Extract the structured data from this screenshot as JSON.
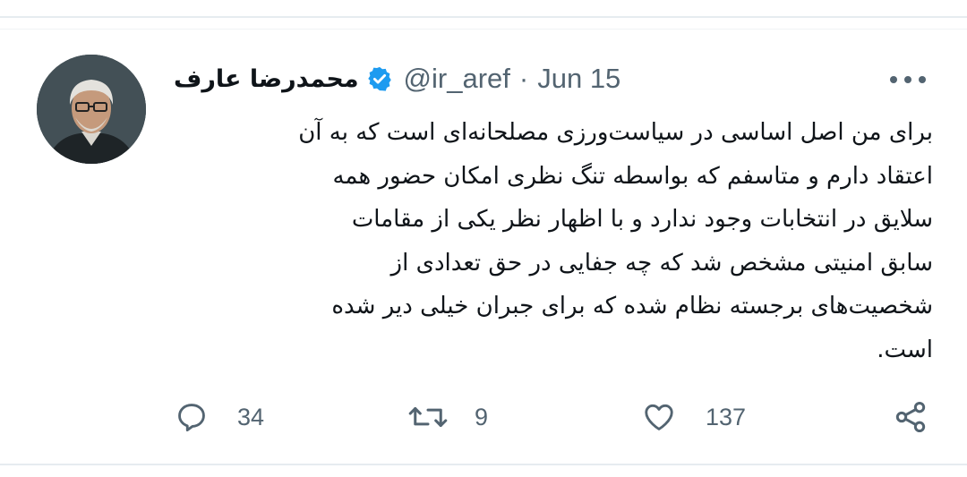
{
  "tweet": {
    "author": {
      "display_name": "محمدرضا عارف",
      "handle": "@ir_aref",
      "verified": true,
      "avatar_icon": "user-avatar-photo"
    },
    "separator": "·",
    "date": "Jun 15",
    "text_lines": [
      "برای من اصل اساسی در  سیاست‌ورزی مصلحانه‌ای است که به آن",
      "اعتقاد دارم و متاسفم که بواسطه تنگ نظری امکان حضور همه",
      "سلایق در انتخابات وجود ندارد و با اظهار نظر یکی از مقامات",
      "سابق امنیتی مشخص شد که چه جفایی در حق تعدادی از",
      "شخصیت‌های برجسته نظام شده که برای جبران خیلی دیر شده",
      "است."
    ],
    "actions": {
      "reply": {
        "icon": "reply-icon",
        "count": "34"
      },
      "retweet": {
        "icon": "retweet-icon",
        "count": "9"
      },
      "like": {
        "icon": "heart-icon",
        "count": "137"
      },
      "share": {
        "icon": "share-icon"
      }
    },
    "more_icon": "more-options-icon"
  },
  "colors": {
    "text_primary": "#0f1419",
    "text_secondary": "#536471",
    "verified_blue": "#1d9bf0",
    "divider": "#e6ecf0"
  }
}
